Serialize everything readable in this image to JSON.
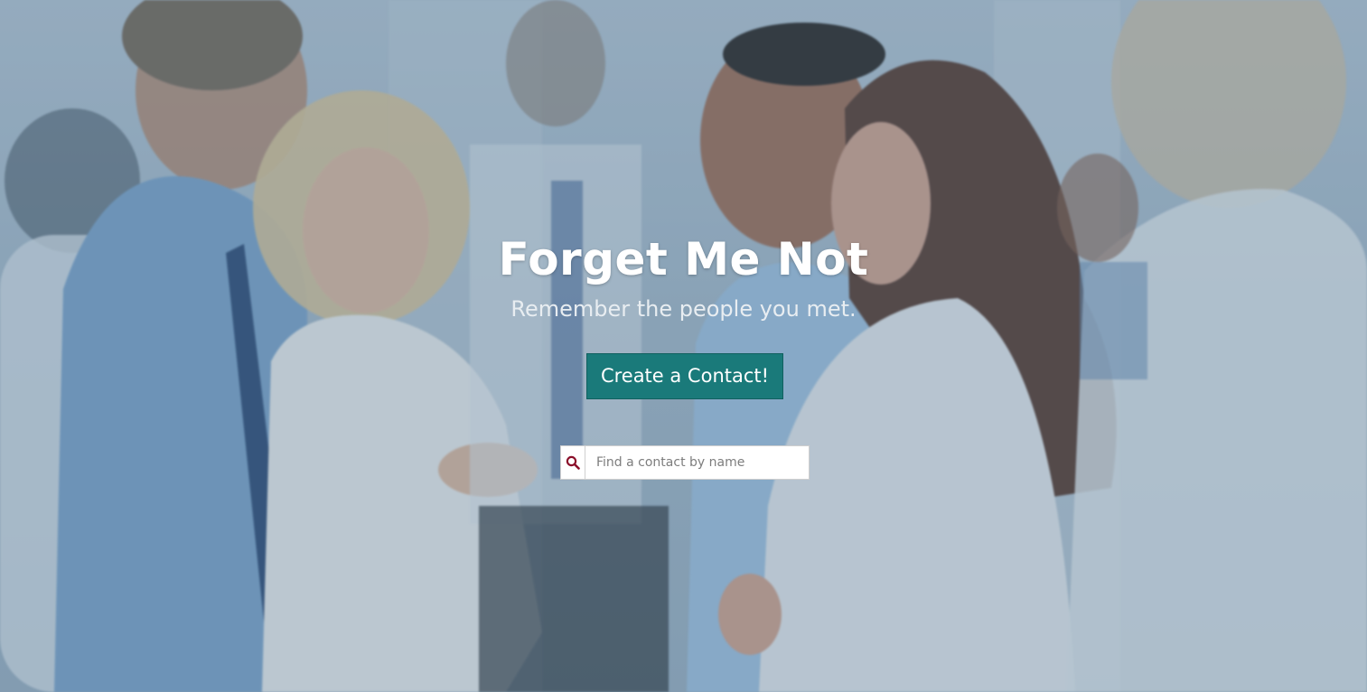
{
  "hero": {
    "title": "Forget Me Not",
    "subtitle": "Remember the people you met.",
    "cta_label": "Create a Contact!",
    "background": "photo of people chatting at a networking event"
  },
  "search": {
    "placeholder": "Find a contact by name",
    "value": "",
    "icon": "search-icon"
  },
  "colors": {
    "button_bg": "#1a7a7a",
    "search_icon": "#8b0f2a",
    "title_text": "#ffffff",
    "subtitle_text": "#e8edf1"
  }
}
